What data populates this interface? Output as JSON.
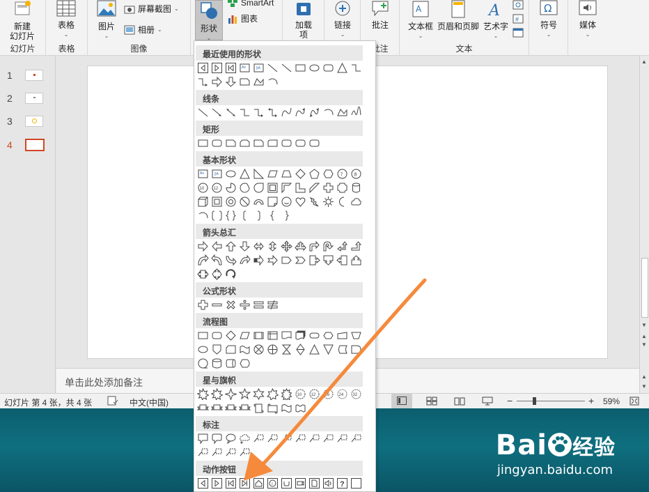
{
  "ribbon": {
    "groups": [
      {
        "label": "幻灯片",
        "buttons": [
          {
            "label": "新建\n幻灯片"
          }
        ]
      },
      {
        "label": "表格",
        "buttons": [
          {
            "label": "表格"
          }
        ]
      },
      {
        "label": "图像",
        "buttons": [
          {
            "label": "图片"
          },
          {
            "label": "屏幕截图"
          },
          {
            "label": "相册"
          }
        ]
      },
      {
        "label": "",
        "buttons": [
          {
            "label": "形状"
          },
          {
            "label": "SmartArt"
          },
          {
            "label": "图表"
          }
        ]
      },
      {
        "label": "",
        "buttons": [
          {
            "label": "加载\n项"
          }
        ]
      },
      {
        "label": "",
        "buttons": [
          {
            "label": "链接"
          }
        ]
      },
      {
        "label": "批注",
        "buttons": [
          {
            "label": "批注"
          }
        ]
      },
      {
        "label": "文本",
        "buttons": [
          {
            "label": "文本框"
          },
          {
            "label": "页眉和页脚"
          },
          {
            "label": "艺术字"
          }
        ]
      },
      {
        "label": "",
        "buttons": [
          {
            "label": "符号"
          }
        ]
      },
      {
        "label": "",
        "buttons": [
          {
            "label": "媒体"
          }
        ]
      }
    ],
    "accent": "#d24726"
  },
  "thumbnails": [
    {
      "number": "1"
    },
    {
      "number": "2"
    },
    {
      "number": "3"
    },
    {
      "number": "4",
      "active": true
    }
  ],
  "notes_placeholder": "单击此处添加备注",
  "status": {
    "slide_info": "幻灯片 第 4 张，共 4 张",
    "language": "中文(中国)",
    "zoom": "59%",
    "zoom_minus": "−",
    "zoom_plus": "+"
  },
  "shapes_menu": {
    "sections": [
      {
        "title": "最近使用的形状"
      },
      {
        "title": "线条"
      },
      {
        "title": "矩形"
      },
      {
        "title": "基本形状"
      },
      {
        "title": "箭头总汇"
      },
      {
        "title": "公式形状"
      },
      {
        "title": "流程图"
      },
      {
        "title": "星与旗帜"
      },
      {
        "title": "标注"
      },
      {
        "title": "动作按钮"
      }
    ]
  },
  "banner": {
    "brand": "Bai",
    "brand_suffix": "经验",
    "url": "jingyan.baidu.com"
  },
  "colors": {
    "arrow": "#f58a3c",
    "banner": "#0f6f7f"
  }
}
